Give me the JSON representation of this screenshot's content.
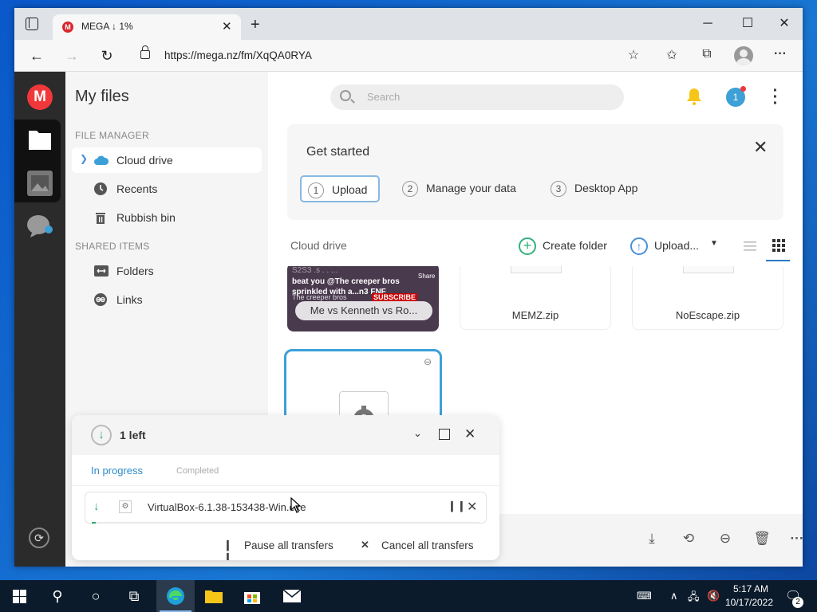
{
  "browser": {
    "tab_title": "MEGA ↓ 1%",
    "tab_favicon": "M",
    "url": "https://mega.nz/fm/XqQA0RYA",
    "window_controls": [
      "minimize-icon",
      "maximize-icon",
      "close-icon"
    ]
  },
  "app": {
    "logo_letter": "M",
    "sidebar": {
      "title": "My files",
      "section_file_manager": "FILE MANAGER",
      "items": [
        {
          "label": "Cloud drive",
          "icon": "cloud-icon",
          "active": true
        },
        {
          "label": "Recents",
          "icon": "clock-icon"
        },
        {
          "label": "Rubbish bin",
          "icon": "trash-icon"
        }
      ],
      "section_shared": "SHARED ITEMS",
      "shared_items": [
        {
          "label": "Folders",
          "icon": "shared-folder-icon"
        },
        {
          "label": "Links",
          "icon": "link-icon"
        }
      ]
    },
    "header": {
      "search_placeholder": "Search",
      "avatar_letter": "1"
    },
    "get_started": {
      "title": "Get started",
      "steps": [
        {
          "num": "1",
          "label": "Upload"
        },
        {
          "num": "2",
          "label": "Manage your data"
        },
        {
          "num": "3",
          "label": "Desktop App"
        }
      ]
    },
    "toolbar": {
      "breadcrumb": "Cloud drive",
      "create_folder": "Create folder",
      "upload": "Upload..."
    },
    "files": [
      {
        "name": "Me vs Kenneth vs Ro...",
        "type": "video"
      },
      {
        "name": "MEMZ.zip",
        "type": "zip"
      },
      {
        "name": "NoEscape.zip",
        "type": "zip"
      }
    ],
    "thumbnail_text": {
      "line1": "beat you @The creeper bros",
      "line2": "sprinkled with a...n3 FNF",
      "line3": "The creeper bros",
      "subscribe": "SUBSCRIBE",
      "share": "Share"
    }
  },
  "transfers": {
    "count": "1 left",
    "tab_in_progress": "In progress",
    "tab_completed": "Completed",
    "items": [
      {
        "name": "VirtualBox-6.1.38-153438-Win.exe",
        "progress_fraction": 0.01
      }
    ],
    "pause_all": "Pause all transfers",
    "cancel_all": "Cancel all transfers"
  },
  "taskbar": {
    "time": "5:17 AM",
    "date": "10/17/2022",
    "notifications": "2"
  },
  "colors": {
    "mega_red": "#f0373a",
    "accent_blue": "#3ca0d8",
    "progress_green": "#2fa86b",
    "taskbar": "#0b1b2c"
  }
}
